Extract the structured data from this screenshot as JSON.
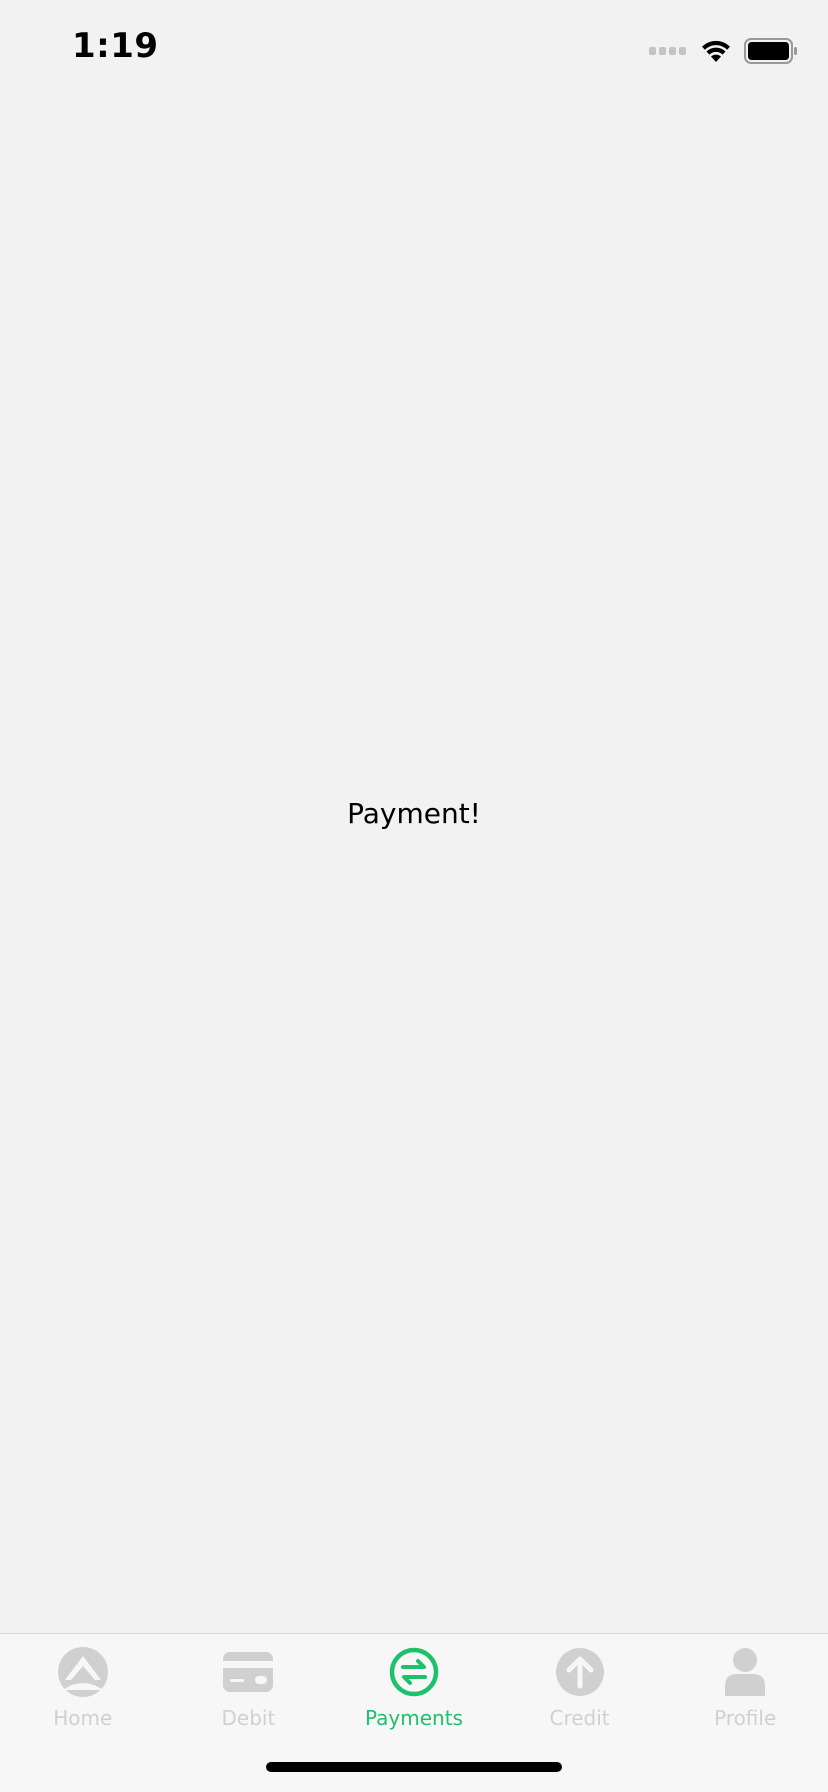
{
  "status_bar": {
    "time": "1:19",
    "icons": [
      "signal-icon",
      "wifi-icon",
      "battery-icon"
    ]
  },
  "main": {
    "text": "Payment!"
  },
  "tab_bar": {
    "active_color": "#1ec16b",
    "inactive_color": "#d0d0d0",
    "tabs": [
      {
        "label": "Home",
        "icon": "home-icon",
        "active": false
      },
      {
        "label": "Debit",
        "icon": "card-icon",
        "active": false
      },
      {
        "label": "Payments",
        "icon": "exchange-icon",
        "active": true
      },
      {
        "label": "Credit",
        "icon": "arrow-up-circle-icon",
        "active": false
      },
      {
        "label": "Profile",
        "icon": "person-icon",
        "active": false
      }
    ]
  }
}
